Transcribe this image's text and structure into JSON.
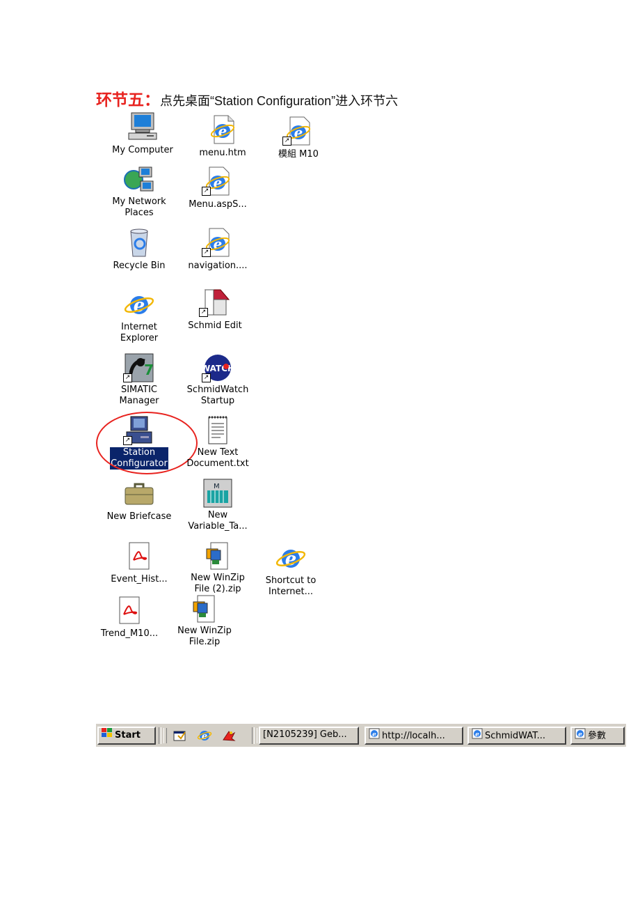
{
  "heading": {
    "step": "环节五：",
    "instruction": "点先桌面“Station Configuration”进入环节六"
  },
  "icons": [
    {
      "label": "My Computer",
      "icon": "my-computer-icon"
    },
    {
      "label": "menu.htm",
      "icon": "ie-document-icon"
    },
    {
      "label": "模組 M10",
      "icon": "ie-shortcut-icon"
    },
    {
      "label": "My Network\nPlaces",
      "icon": "network-places-icon"
    },
    {
      "label": "Menu.aspS...",
      "icon": "ie-shortcut-icon"
    },
    {
      "label": "Recycle Bin",
      "icon": "recycle-bin-icon"
    },
    {
      "label": "navigation....",
      "icon": "ie-shortcut-icon"
    },
    {
      "label": "Internet\nExplorer",
      "icon": "internet-explorer-icon"
    },
    {
      "label": "Schmid Edit",
      "icon": "schmid-edit-icon"
    },
    {
      "label": "SIMATIC\nManager",
      "icon": "simatic-manager-icon"
    },
    {
      "label": "SchmidWatch\nStartup",
      "icon": "schmidwatch-icon"
    },
    {
      "label": "Station\nConfigurator",
      "icon": "station-configurator-icon"
    },
    {
      "label": "New Text\nDocument.txt",
      "icon": "text-document-icon"
    },
    {
      "label": "New Briefcase",
      "icon": "briefcase-icon"
    },
    {
      "label": "New\nVariable_Ta...",
      "icon": "variable-table-icon"
    },
    {
      "label": "Event_Hist...",
      "icon": "pdf-icon"
    },
    {
      "label": "New WinZip\nFile (2).zip",
      "icon": "winzip-icon"
    },
    {
      "label": "Shortcut to\nInternet...",
      "icon": "internet-explorer-icon"
    },
    {
      "label": "Trend_M10...",
      "icon": "pdf-icon"
    },
    {
      "label": "New WinZip\nFile.zip",
      "icon": "winzip-icon"
    }
  ],
  "taskbar": {
    "start_label": "Start",
    "quick_launch": [
      "show-desktop-icon",
      "internet-explorer-icon",
      "launch-icon"
    ],
    "tasks": [
      {
        "label": "[N2105239] Geb...",
        "icon": "none"
      },
      {
        "label": "http://localh...",
        "icon": "ie-page-icon"
      },
      {
        "label": "SchmidWAT...",
        "icon": "ie-page-icon"
      },
      {
        "label": "參數",
        "icon": "ie-page-icon"
      }
    ]
  },
  "colors": {
    "heading_step": "#e8231f",
    "selection": "#0a246a",
    "annotation_circle": "#e8231f",
    "taskbar": "#d4d0c8"
  }
}
